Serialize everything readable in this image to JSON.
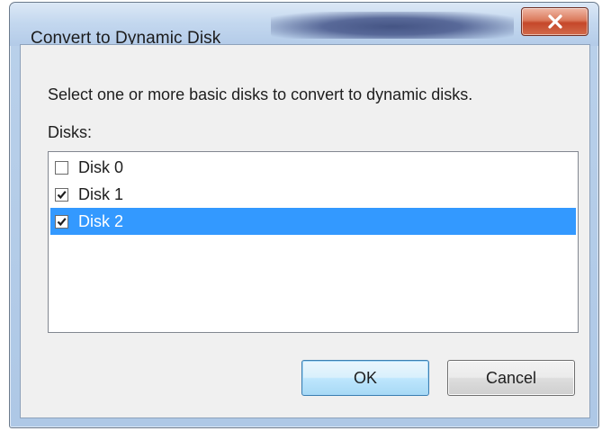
{
  "window": {
    "title": "Convert to Dynamic Disk",
    "close_label": "x"
  },
  "dialog": {
    "instruction": "Select one or more basic disks to convert to dynamic disks.",
    "disks_label": "Disks:"
  },
  "disks": [
    {
      "label": "Disk 0",
      "checked": false,
      "selected": false
    },
    {
      "label": "Disk 1",
      "checked": true,
      "selected": false
    },
    {
      "label": "Disk 2",
      "checked": true,
      "selected": true
    }
  ],
  "buttons": {
    "ok_label": "OK",
    "cancel_label": "Cancel"
  },
  "colors": {
    "selection": "#3399ff",
    "close_button": "#c5472a",
    "title_glow": "#2f3e72"
  }
}
